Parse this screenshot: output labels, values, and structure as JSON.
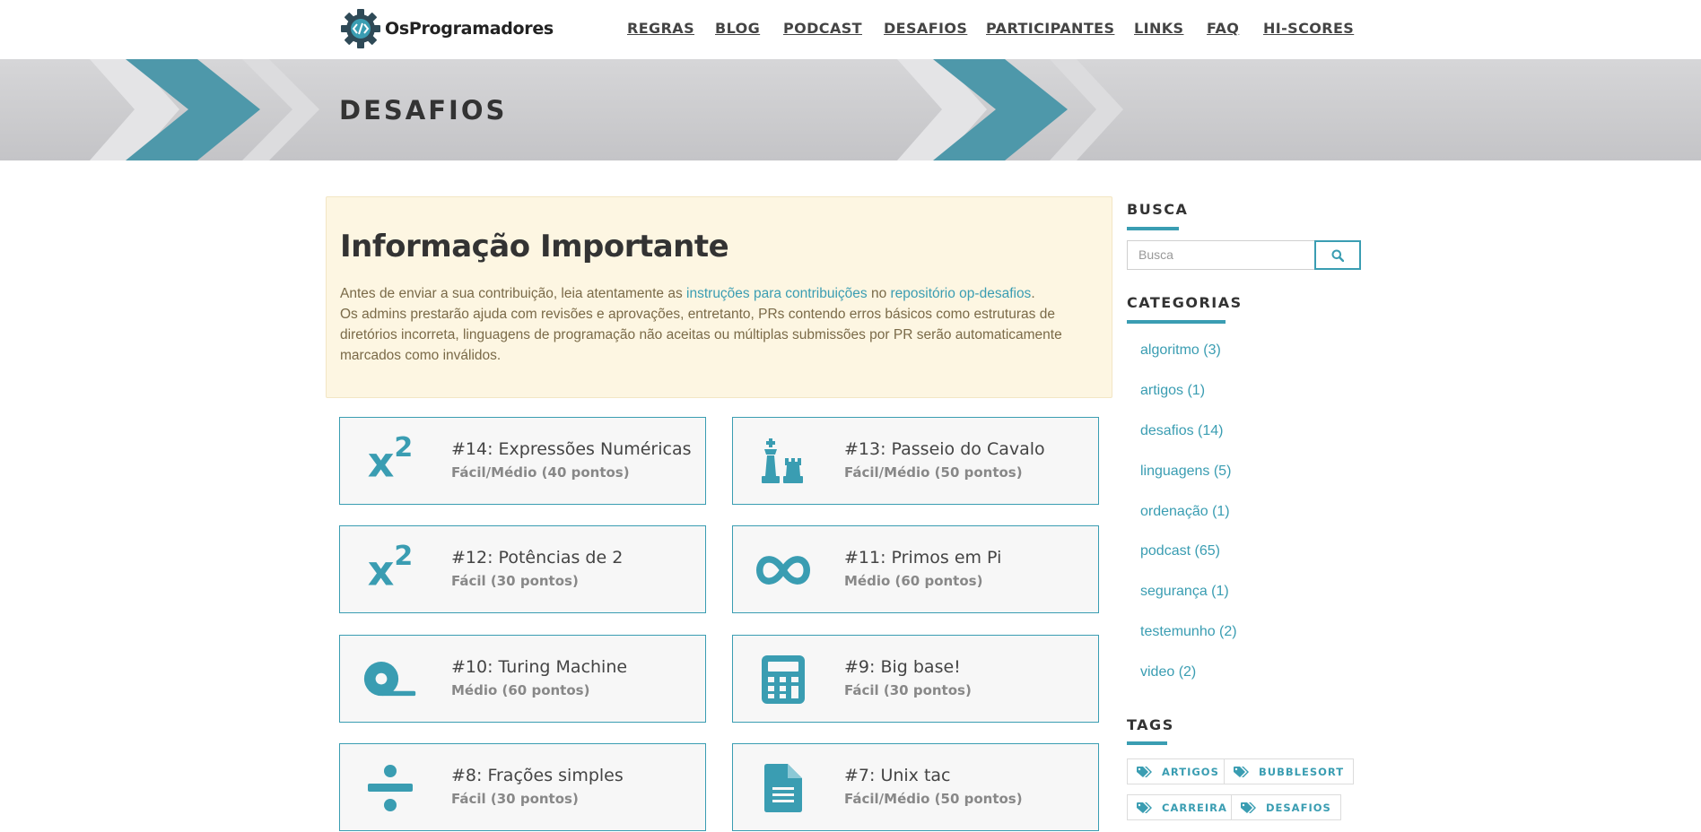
{
  "brand": {
    "name": "OsProgramadores",
    "logo_icon": "gear-code-icon"
  },
  "nav": [
    {
      "label": "REGRAS"
    },
    {
      "label": "BLOG"
    },
    {
      "label": "PODCAST"
    },
    {
      "label": "DESAFIOS"
    },
    {
      "label": "PARTICIPANTES"
    },
    {
      "label": "LINKS"
    },
    {
      "label": "FAQ"
    },
    {
      "label": "HI-SCORES"
    }
  ],
  "banner": {
    "title": "DESAFIOS"
  },
  "info": {
    "title": "Informação Importante",
    "line1_prefix": "Antes de enviar a sua contribuição, leia atentamente as ",
    "link1": "instruções para contribuições",
    "line1_mid": " no ",
    "link2": "repositório op-desafios",
    "line1_suffix": ".",
    "line2": "Os admins prestarão ajuda com revisões e aprovações, entretanto, PRs contendo erros básicos como estruturas de diretórios incorreta, linguagens de programação não aceitas ou múltiplas submissões por PR serão automaticamente marcados como inválidos."
  },
  "cards": [
    {
      "title": "#14: Expressões Numéricas",
      "subtitle": "Fácil/Médio (40 pontos)",
      "icon": "superscript-icon"
    },
    {
      "title": "#13: Passeio do Cavalo",
      "subtitle": "Fácil/Médio (50 pontos)",
      "icon": "chess-icon"
    },
    {
      "title": "#12: Potências de 2",
      "subtitle": "Fácil (30 pontos)",
      "icon": "superscript-icon"
    },
    {
      "title": "#11: Primos em Pi",
      "subtitle": "Médio (60 pontos)",
      "icon": "infinity-icon"
    },
    {
      "title": "#10: Turing Machine",
      "subtitle": "Médio (60 pontos)",
      "icon": "tape-icon"
    },
    {
      "title": "#9: Big base!",
      "subtitle": "Fácil (30 pontos)",
      "icon": "calculator-icon"
    },
    {
      "title": "#8: Frações simples",
      "subtitle": "Fácil (30 pontos)",
      "icon": "divide-icon"
    },
    {
      "title": "#7: Unix tac",
      "subtitle": "Fácil/Médio (50 pontos)",
      "icon": "file-text-icon"
    }
  ],
  "sidebar": {
    "search_heading": "BUSCA",
    "search_placeholder": "Busca",
    "categories_heading": "CATEGORIAS",
    "categories": [
      {
        "label": "algoritmo (3)"
      },
      {
        "label": "artigos (1)"
      },
      {
        "label": "desafios (14)"
      },
      {
        "label": "linguagens (5)"
      },
      {
        "label": "ordenação (1)"
      },
      {
        "label": "podcast (65)"
      },
      {
        "label": "segurança (1)"
      },
      {
        "label": "testemunho (2)"
      },
      {
        "label": "video (2)"
      }
    ],
    "tags_heading": "TAGS",
    "tags": [
      {
        "label": "ARTIGOS"
      },
      {
        "label": "BUBBLESORT"
      },
      {
        "label": "CARREIRA"
      },
      {
        "label": "DESAFIOS"
      }
    ]
  },
  "colors": {
    "accent": "#3a9db2",
    "info_bg": "#fdf6e2"
  }
}
